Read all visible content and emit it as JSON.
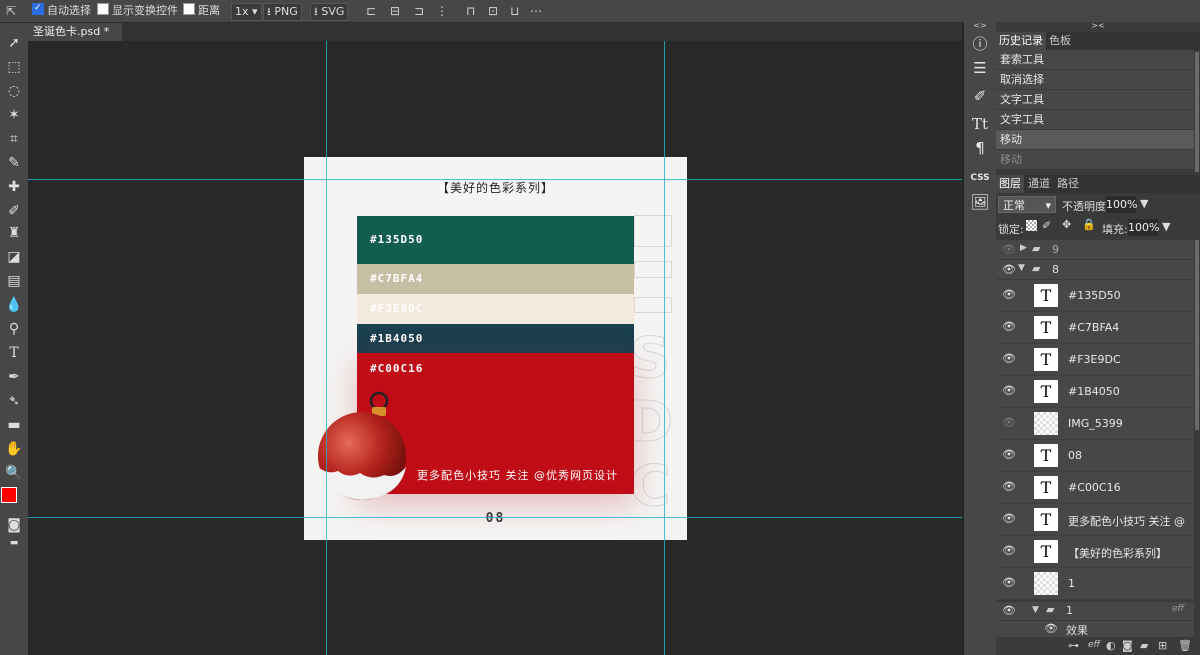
{
  "topbar": {
    "auto_select_label": "自动选择",
    "show_transform_label": "显示变换控件",
    "distance_label": "距离",
    "zoom": "1x",
    "export_png": "PNG",
    "export_svg": "SVG"
  },
  "document": {
    "tab_title": "圣诞色卡.psd *",
    "close_symbol": "✕"
  },
  "canvas": {
    "title": "【美好的色彩系列】",
    "swatches": [
      {
        "label": "#135D50",
        "color": "#135D50",
        "text_color": "#ffffff"
      },
      {
        "label": "#C7BFA4",
        "color": "#C7BFA4",
        "text_color": "#ffffff"
      },
      {
        "label": "#F3E9DC",
        "color": "#F3E9DC",
        "text_color": "#ffffff"
      },
      {
        "label": "#1B4050",
        "color": "#1B4050",
        "text_color": "#ffffff"
      },
      {
        "label": "#C00C16",
        "color": "#C00C16",
        "text_color": "#ffffff"
      }
    ],
    "cta": "更多配色小技巧 关注 @优秀网页设计",
    "page_number": "08"
  },
  "right_strip": {
    "css_label": "CSS"
  },
  "history_panel": {
    "tabs": [
      "历史记录",
      "色板"
    ],
    "items": [
      {
        "label": "套索工具",
        "dim": false
      },
      {
        "label": "取消选择",
        "dim": false
      },
      {
        "label": "文字工具",
        "dim": false
      },
      {
        "label": "文字工具",
        "dim": false
      },
      {
        "label": "移动",
        "dim": false
      },
      {
        "label": "移动",
        "dim": true
      }
    ]
  },
  "layers_panel": {
    "tabs": [
      "图层",
      "通道",
      "路径"
    ],
    "blend_mode": "正常",
    "opacity_label": "不透明度:",
    "opacity_value": "100%",
    "lock_label": "锁定:",
    "fill_label": "填充:",
    "fill_value": "100%",
    "folder_9": "9",
    "folder_8": "8",
    "layers": [
      {
        "name": "#135D50",
        "type": "text",
        "visible": true
      },
      {
        "name": "#C7BFA4",
        "type": "text",
        "visible": true
      },
      {
        "name": "#F3E9DC",
        "type": "text",
        "visible": true
      },
      {
        "name": "#1B4050",
        "type": "text",
        "visible": true
      },
      {
        "name": "IMG_5399",
        "type": "image",
        "visible": false
      },
      {
        "name": "08",
        "type": "text",
        "visible": true
      },
      {
        "name": "#C00C16",
        "type": "text",
        "visible": true
      },
      {
        "name": "更多配色小技巧 关注 @",
        "type": "text",
        "visible": true
      },
      {
        "name": "【美好的色彩系列】",
        "type": "text",
        "visible": true
      },
      {
        "name": "1",
        "type": "image",
        "visible": true
      }
    ],
    "folder_1": "1",
    "effects_label": "效果",
    "eff_label": "eff"
  }
}
